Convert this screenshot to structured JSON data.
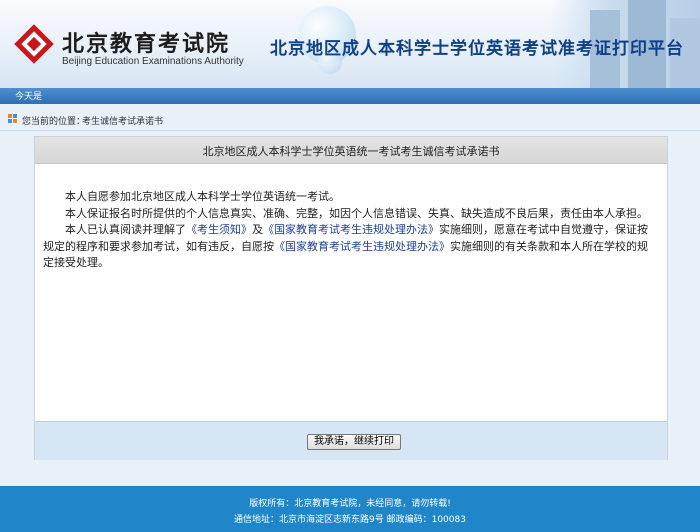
{
  "header": {
    "logo_cn": "北京教育考试院",
    "logo_en": "Beijing Education Examinations Authority",
    "platform_title": "北京地区成人本科学士学位英语考试准考证打印平台",
    "brand_color": "#c8161d",
    "title_color": "#0f3f86",
    "icon": "bjeea-logo-icon"
  },
  "navbar": {
    "today_label": "今天是",
    "color": "#2e6fb5"
  },
  "breadcrumb": {
    "label": "您当前的位置：",
    "current": "考生诚信考试承诺书",
    "icon": "location-icon"
  },
  "panel": {
    "title": "北京地区成人本科学士学位英语统一考试考生诚信考试承诺书",
    "para1": "本人自愿参加北京地区成人本科学士学位英语统一考试。",
    "para2": "本人保证报名时所提供的个人信息真实、准确、完整，如因个人信息错误、失真、缺失造成不良后果，责任由本人承担。",
    "para3_a": "本人已认真阅读并理解了",
    "link1": "《考生须知》",
    "para3_b": "及",
    "link2": "《国家教育考试考生违规处理办法》",
    "para3_c": "实施细则，愿意在考试中自觉遵守，保证按规定的程序和要求参加考试，如有违反，自愿按",
    "link3": "《国家教育考试考生违规处理办法》",
    "para3_d": "实施细则的有关条款和本人所在学校的规定接受处理。",
    "button_label": "我承诺，继续打印"
  },
  "footer": {
    "copyright": "版权所有：北京教育考试院，未经同意，请勿转载!",
    "address": "通信地址：北京市海淀区志新东路9号   邮政编码：100083",
    "color": "#1f87c9"
  }
}
